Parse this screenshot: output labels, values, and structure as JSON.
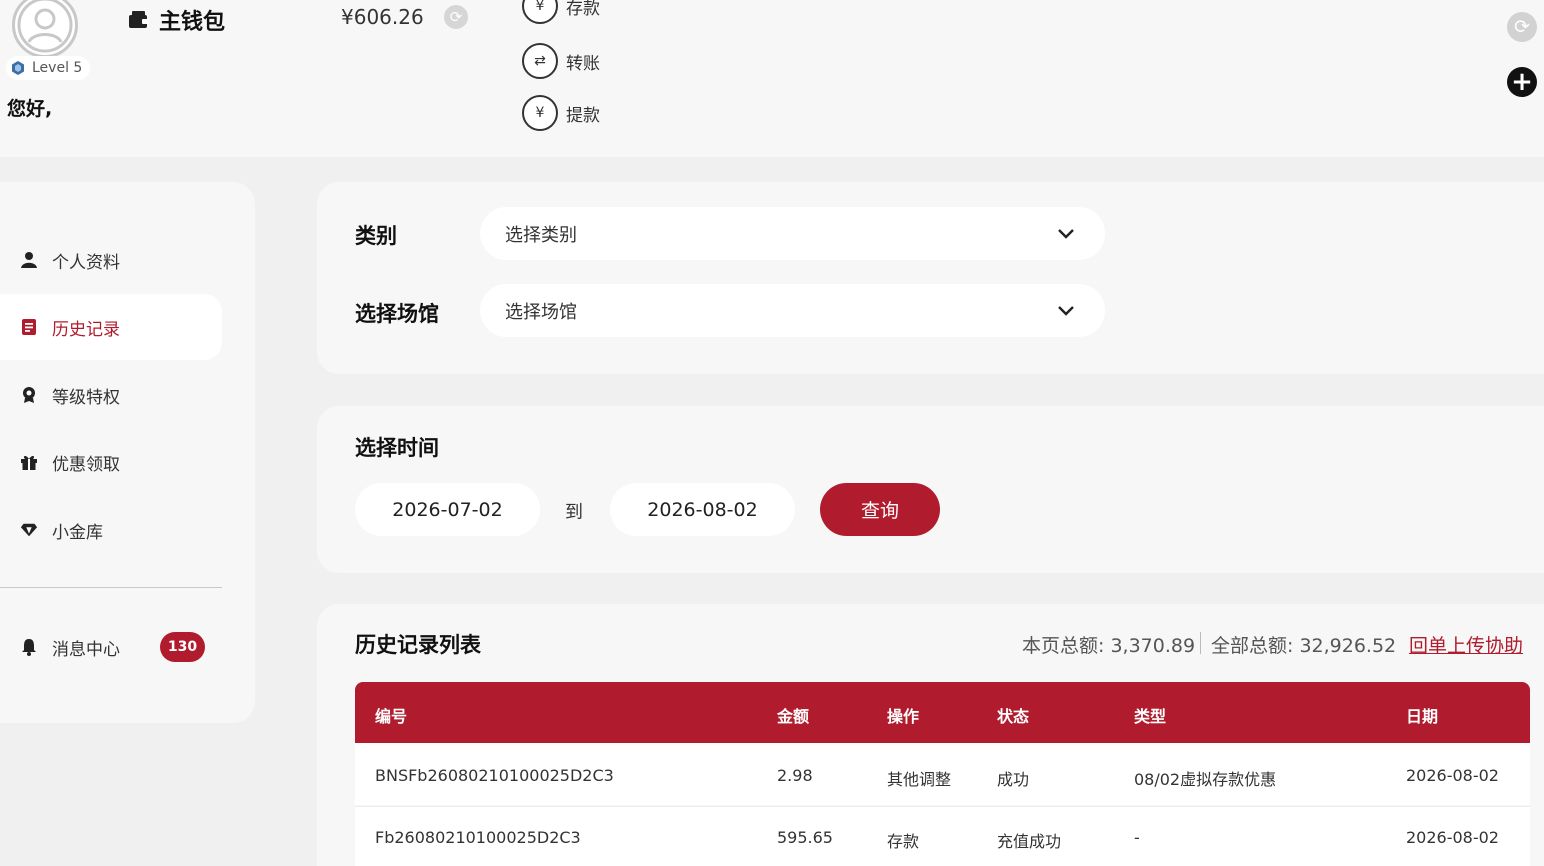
{
  "header": {
    "level": "Level 5",
    "greeting": "您好,",
    "wallet_title": "主钱包",
    "balance": "¥606.26",
    "actions": [
      {
        "label": "存款",
        "icon": "deposit-icon"
      },
      {
        "label": "转账",
        "icon": "transfer-icon"
      },
      {
        "label": "提款",
        "icon": "withdraw-icon"
      }
    ]
  },
  "sidebar": {
    "items": [
      {
        "label": "个人资料",
        "icon": "user-icon"
      },
      {
        "label": "历史记录",
        "icon": "document-icon",
        "active": true
      },
      {
        "label": "等级特权",
        "icon": "medal-icon"
      },
      {
        "label": "优惠领取",
        "icon": "gift-icon"
      },
      {
        "label": "小金库",
        "icon": "diamond-icon"
      }
    ],
    "messages": {
      "label": "消息中心",
      "icon": "bell-icon",
      "count": "130"
    }
  },
  "filters": {
    "category_label": "类别",
    "category_placeholder": "选择类别",
    "venue_label": "选择场馆",
    "venue_placeholder": "选择场馆",
    "time_label": "选择时间",
    "date_from": "2026-07-02",
    "to_label": "到",
    "date_to": "2026-08-02",
    "query_button": "查询"
  },
  "history": {
    "title": "历史记录列表",
    "page_total": "本页总额: 3,370.89",
    "all_total": "全部总额: 32,926.52",
    "upload_link": "回单上传协助",
    "columns": [
      "编号",
      "金额",
      "操作",
      "状态",
      "类型",
      "日期"
    ],
    "rows": [
      {
        "id": "BNSFb26080210100025D2C3",
        "amount": "2.98",
        "action": "其他调整",
        "status": "成功",
        "type": "08/02虚拟存款优惠",
        "date": "2026-08-02"
      },
      {
        "id": "Fb26080210100025D2C3",
        "amount": "595.65",
        "action": "存款",
        "status": "充值成功",
        "type": "-",
        "date": "2026-08-02"
      }
    ]
  },
  "colors": {
    "accent": "#b01c2e",
    "panel": "#f7f7f7",
    "background": "#f0f0f0"
  }
}
